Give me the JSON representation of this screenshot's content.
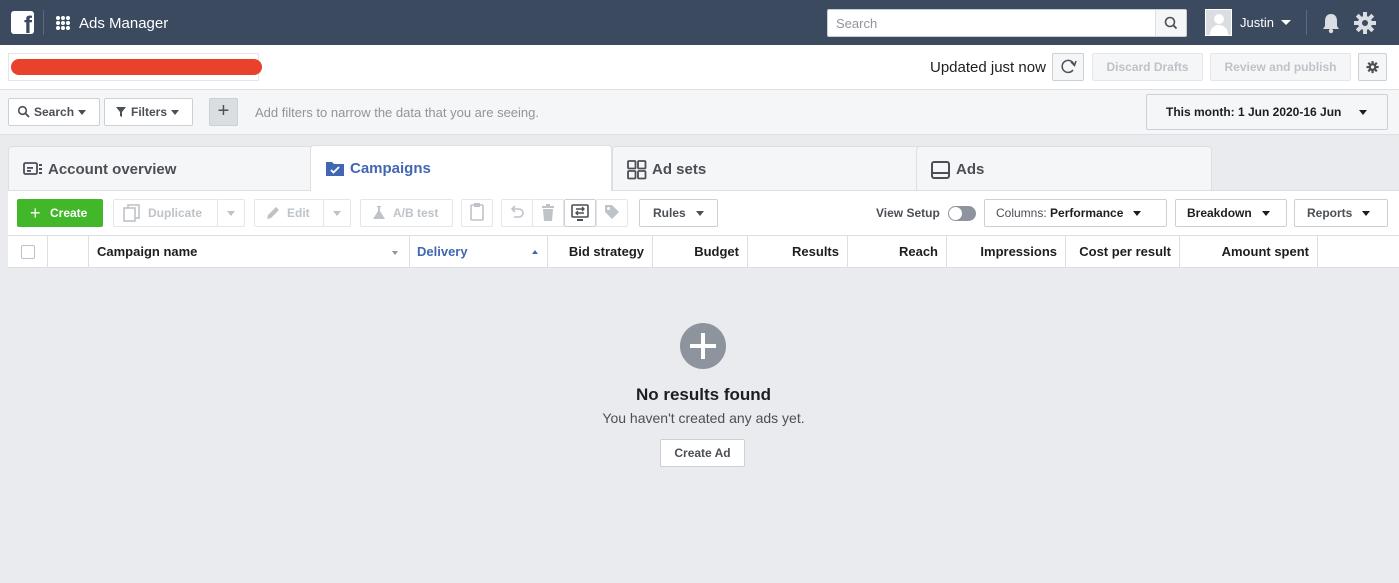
{
  "topbar": {
    "logo_letter": "f",
    "app_title": "Ads Manager",
    "search_placeholder": "Search",
    "user_name": "Justin",
    "background": "#3b4a5f"
  },
  "subbar": {
    "status": "Updated just now",
    "discard_label": "Discard Drafts",
    "review_label": "Review and publish"
  },
  "filterbar": {
    "search_label": "Search",
    "filters_label": "Filters",
    "hint": "Add filters to narrow the data that you are seeing.",
    "date_range": "This month: 1 Jun 2020-16 Jun"
  },
  "tabs": [
    {
      "label": "Account overview",
      "icon": "account-overview-icon"
    },
    {
      "label": "Campaigns",
      "icon": "campaigns-folder-icon",
      "active": true
    },
    {
      "label": "Ad sets",
      "icon": "ad-sets-grid-icon"
    },
    {
      "label": "Ads",
      "icon": "ads-icon"
    }
  ],
  "toolbar": {
    "create_label": "Create",
    "duplicate_label": "Duplicate",
    "edit_label": "Edit",
    "ab_test_label": "A/B test",
    "rules_label": "Rules",
    "view_setup_label": "View Setup",
    "columns_prefix": "Columns:",
    "columns_value": "Performance",
    "breakdown_label": "Breakdown",
    "reports_label": "Reports",
    "create_color": "#42b72a"
  },
  "table": {
    "columns": [
      "Campaign name",
      "Delivery",
      "Bid strategy",
      "Budget",
      "Results",
      "Reach",
      "Impressions",
      "Cost per result",
      "Amount spent"
    ]
  },
  "empty_state": {
    "title": "No results found",
    "subtitle": "You haven't created any ads yet.",
    "button_label": "Create Ad"
  }
}
